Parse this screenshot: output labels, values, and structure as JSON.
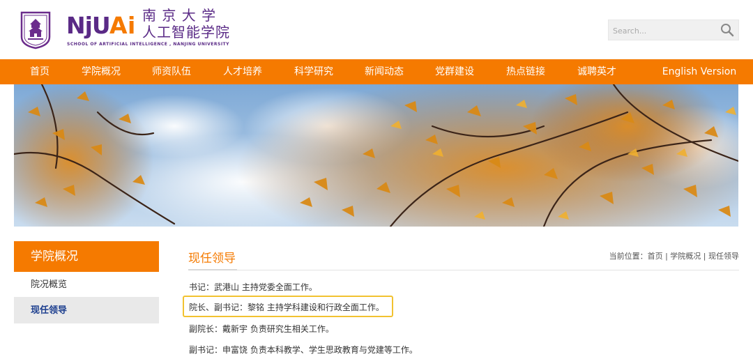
{
  "header": {
    "logo_mark": "NJUAi",
    "logo_cn_line1": "南 京 大 学",
    "logo_cn_line2": "人工智能学院",
    "logo_en": "School of Artificial Intelligence , Nanjing University",
    "search_placeholder": "Search...",
    "colors": {
      "brand_purple": "#5a2a86",
      "accent_orange": "#f57a00"
    }
  },
  "nav": {
    "items": [
      {
        "label": "首页"
      },
      {
        "label": "学院概况"
      },
      {
        "label": "师资队伍"
      },
      {
        "label": "人才培养"
      },
      {
        "label": "科学研究"
      },
      {
        "label": "新闻动态"
      },
      {
        "label": "党群建设"
      },
      {
        "label": "热点链接"
      },
      {
        "label": "诚聘英才"
      },
      {
        "label": "English Version"
      }
    ]
  },
  "sidebar": {
    "title": "学院概况",
    "items": [
      {
        "label": "院况概览"
      },
      {
        "label": "现任领导"
      }
    ]
  },
  "main": {
    "title": "现任领导",
    "breadcrumb": {
      "prefix": "当前位置：",
      "home": "首页",
      "sep": " | ",
      "section": "学院概况",
      "page": "现任领导"
    },
    "leaders": [
      {
        "text": "书记：武港山 主持党委全面工作。"
      },
      {
        "text": "院长、副书记：黎铭 主持学科建设和行政全面工作。"
      },
      {
        "text": "副院长：戴新宇 负责研究生相关工作。"
      },
      {
        "text": "副书记：申富饶 负责本科教学、学生思政教育与党建等工作。"
      }
    ]
  }
}
